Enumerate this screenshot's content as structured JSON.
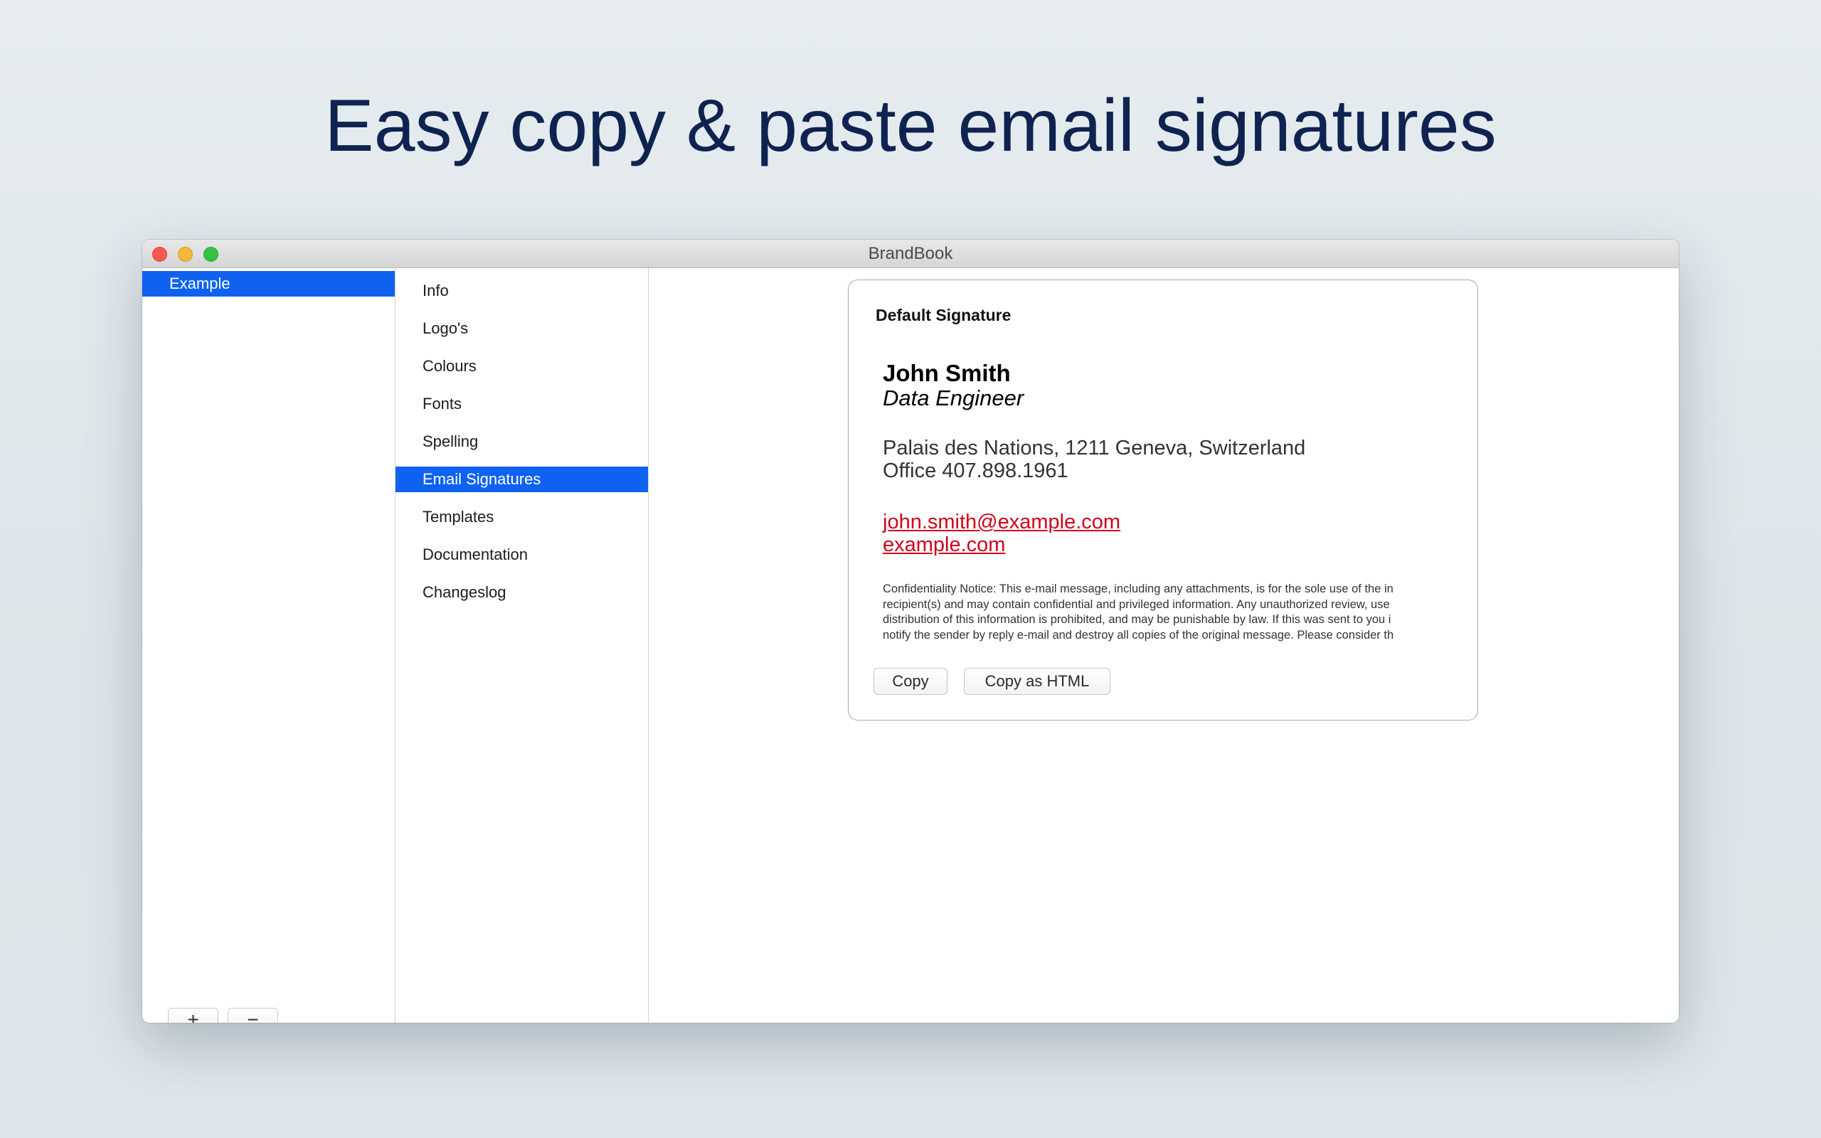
{
  "headline": "Easy copy & paste email signatures",
  "window": {
    "title": "BrandBook"
  },
  "brands": {
    "items": [
      "Example"
    ],
    "selected_index": 0,
    "add_label": "+",
    "remove_label": "−"
  },
  "sections": {
    "items": [
      "Info",
      "Logo's",
      "Colours",
      "Fonts",
      "Spelling",
      "Email Signatures",
      "Templates",
      "Documentation",
      "Changeslog"
    ],
    "selected_index": 5
  },
  "signature": {
    "card_title": "Default Signature",
    "name": "John Smith",
    "role": "Data Engineer",
    "address": "Palais des Nations, 1211 Geneva, Switzerland",
    "phone": "Office 407.898.1961",
    "email": "john.smith@example.com",
    "website": "example.com",
    "notice_lines": [
      "Confidentiality Notice: This e-mail message, including any attachments, is for the sole use of the in",
      "recipient(s) and may contain confidential and privileged information. Any unauthorized review, use",
      "distribution of this information is prohibited, and may be punishable by law. If this was sent to you i",
      "notify the sender by reply e-mail and destroy all copies of the original message. Please consider th"
    ],
    "copy_label": "Copy",
    "copy_html_label": "Copy as HTML"
  },
  "colors": {
    "selection": "#0f62f0",
    "link": "#d0021b",
    "headline": "#0f2350",
    "close": "#f55a51",
    "minimize": "#f6b83a",
    "maximize": "#35c245"
  }
}
